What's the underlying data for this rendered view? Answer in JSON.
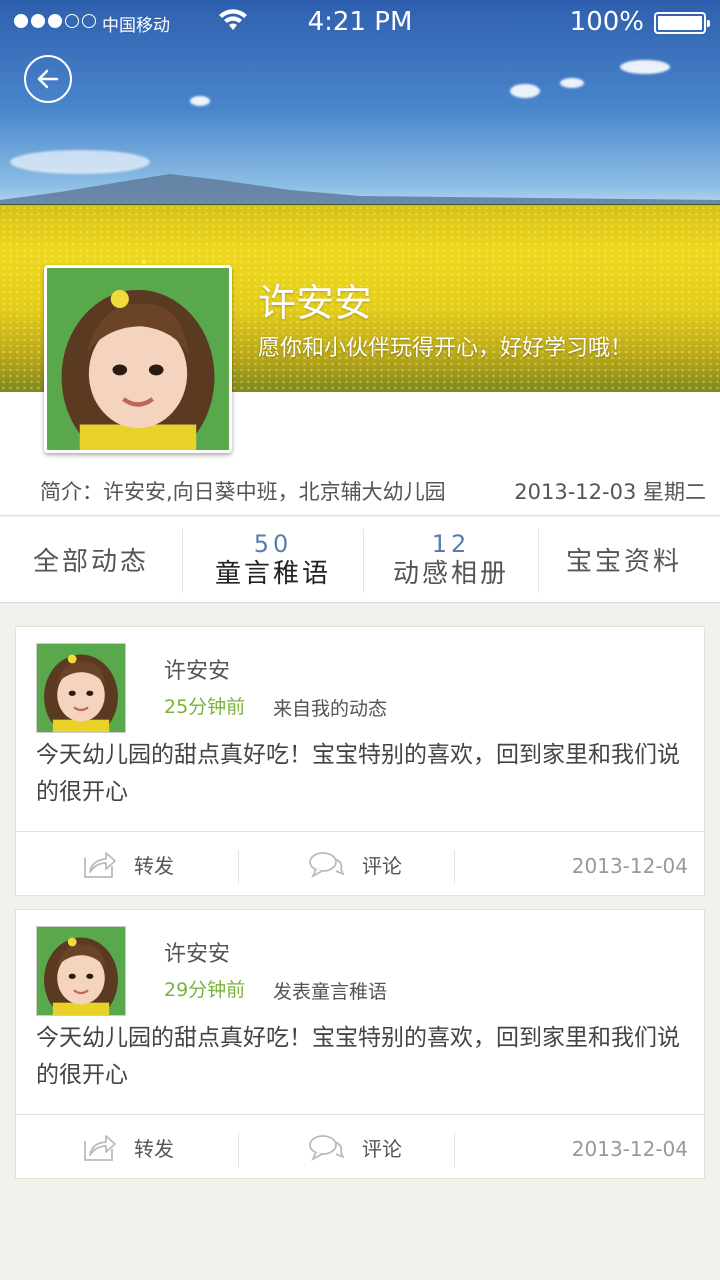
{
  "status_bar": {
    "carrier": "中国移动",
    "time": "4:21 PM",
    "battery_percent": "100%",
    "signal_bars_filled": 3,
    "signal_bars_total": 5
  },
  "header": {
    "back_icon": "back-arrow-icon",
    "name": "许安安",
    "motto": "愿你和小伙伴玩得开心，好好学习哦！"
  },
  "info": {
    "intro": "简介：许安安,向日葵中班，北京辅大幼儿园",
    "date": "2013-12-03  星期二"
  },
  "tabs": [
    {
      "label": "全部动态",
      "count": ""
    },
    {
      "label": "童言稚语",
      "count": "50",
      "active": true
    },
    {
      "label": "动感相册",
      "count": "12"
    },
    {
      "label": "宝宝资料",
      "count": ""
    }
  ],
  "posts": [
    {
      "name": "许安安",
      "ago": "25分钟前",
      "source": "来自我的动态",
      "body": "今天幼儿园的甜点真好吃！宝宝特别的喜欢，回到家里和我们说的很开心",
      "share_label": "转发",
      "comment_label": "评论",
      "date": "2013-12-04"
    },
    {
      "name": "许安安",
      "ago": "29分钟前",
      "source": "发表童言稚语",
      "body": "今天幼儿园的甜点真好吃！宝宝特别的喜欢，回到家里和我们说的很开心",
      "share_label": "转发",
      "comment_label": "评论",
      "date": "2013-12-04"
    }
  ],
  "colors": {
    "accent_green": "#7ab23b",
    "count_blue": "#5a7ea8",
    "background": "#f3f1ec"
  }
}
